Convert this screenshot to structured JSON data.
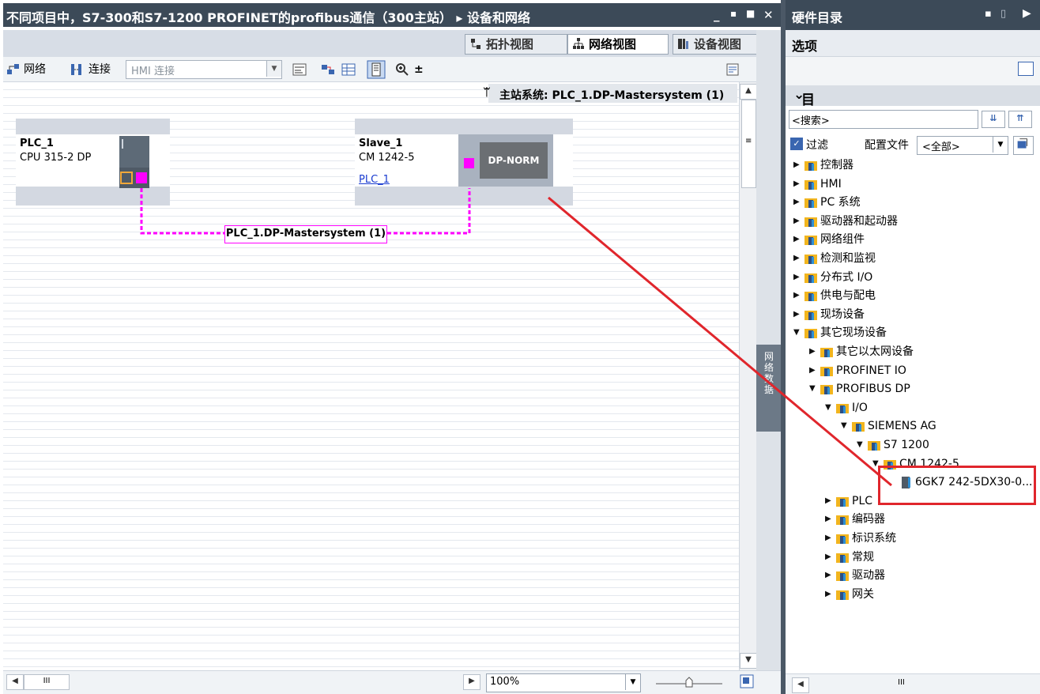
{
  "window": {
    "title": "不同项目中，S7-300和S7-1200 PROFINET的profibus通信（300主站） ▸ 设备和网络",
    "controls": [
      "_",
      "▪",
      "■",
      "✕"
    ]
  },
  "view_tabs": [
    {
      "label": "拓扑视图",
      "active": false
    },
    {
      "label": "网络视图",
      "active": true
    },
    {
      "label": "设备视图",
      "active": false
    }
  ],
  "toolbar": {
    "network_label": "网络",
    "connect_label": "连接",
    "hmi_placeholder": "HMI 连接"
  },
  "canvas": {
    "master_banner": "主站系统: PLC_1.DP-Mastersystem (1)",
    "plc": {
      "name": "PLC_1",
      "type": "CPU 315-2 DP"
    },
    "slave": {
      "name": "Slave_1",
      "type": "CM 1242-5",
      "link": "PLC_1",
      "module_label": "DP-NORM"
    },
    "network_label": "PLC_1.DP-Mastersystem (1)"
  },
  "side_strip_label": "网络数据",
  "bottom": {
    "zoom": "100%",
    "hscroll": "III"
  },
  "right_panel": {
    "title": "硬件目录",
    "options_label": "选项",
    "catalog_label": "目录",
    "search_placeholder": "<搜索>",
    "filter_label": "过滤",
    "filter_checked": true,
    "profile_label": "配置文件",
    "profile_value": "<全部>",
    "hscroll": "III",
    "tree": [
      {
        "label": "控制器",
        "level": 0,
        "expanded": false
      },
      {
        "label": "HMI",
        "level": 0,
        "expanded": false
      },
      {
        "label": "PC 系统",
        "level": 0,
        "expanded": false
      },
      {
        "label": "驱动器和起动器",
        "level": 0,
        "expanded": false
      },
      {
        "label": "网络组件",
        "level": 0,
        "expanded": false
      },
      {
        "label": "检测和监视",
        "level": 0,
        "expanded": false
      },
      {
        "label": "分布式 I/O",
        "level": 0,
        "expanded": false
      },
      {
        "label": "供电与配电",
        "level": 0,
        "expanded": false
      },
      {
        "label": "现场设备",
        "level": 0,
        "expanded": false
      },
      {
        "label": "其它现场设备",
        "level": 0,
        "expanded": true
      },
      {
        "label": "其它以太网设备",
        "level": 1,
        "expanded": false
      },
      {
        "label": "PROFINET IO",
        "level": 1,
        "expanded": false
      },
      {
        "label": "PROFIBUS DP",
        "level": 1,
        "expanded": true
      },
      {
        "label": "I/O",
        "level": 2,
        "expanded": true
      },
      {
        "label": "SIEMENS AG",
        "level": 3,
        "expanded": true
      },
      {
        "label": "S7 1200",
        "level": 4,
        "expanded": true
      },
      {
        "label": "CM 1242-5",
        "level": 5,
        "expanded": true
      },
      {
        "label": "6GK7 242-5DX30-0...",
        "level": 6,
        "expanded": null,
        "highlighted": true
      },
      {
        "label": "PLC",
        "level": 2,
        "expanded": false
      },
      {
        "label": "编码器",
        "level": 2,
        "expanded": false
      },
      {
        "label": "标识系统",
        "level": 2,
        "expanded": false
      },
      {
        "label": "常规",
        "level": 2,
        "expanded": false
      },
      {
        "label": "驱动器",
        "level": 2,
        "expanded": false
      },
      {
        "label": "网关",
        "level": 2,
        "expanded": false
      }
    ]
  },
  "colors": {
    "titlebar": "#3c4a58",
    "profibus_line": "#ff00ff",
    "highlight": "#e0262c",
    "folder": "#f2b51e",
    "arrow": "#e0262c"
  }
}
